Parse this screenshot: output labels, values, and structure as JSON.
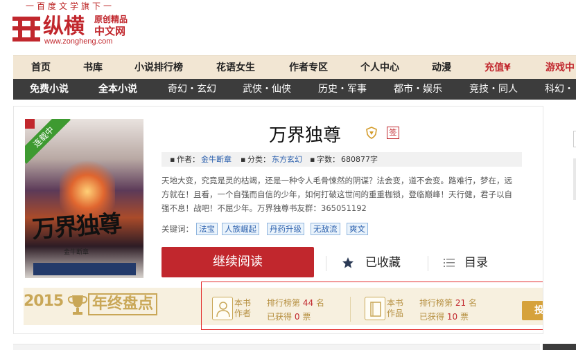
{
  "header": {
    "slogan": "一百度文学旗下一",
    "logo_main": "纵横",
    "logo_sub1": "原创精品",
    "logo_sub2": "中文网",
    "logo_url": "www.zongheng.com"
  },
  "nav_main": [
    {
      "label": "首页"
    },
    {
      "label": "书库"
    },
    {
      "label": "小说排行榜"
    },
    {
      "label": "花语女生"
    },
    {
      "label": "作者专区"
    },
    {
      "label": "个人中心"
    },
    {
      "label": "动漫"
    },
    {
      "label": "充值¥"
    },
    {
      "label": "游戏中"
    }
  ],
  "nav_sub": [
    {
      "label": "免费小说"
    },
    {
      "label": "全本小说"
    },
    {
      "label": "奇幻・玄幻"
    },
    {
      "label": "武侠・仙侠"
    },
    {
      "label": "历史・军事"
    },
    {
      "label": "都市・娱乐"
    },
    {
      "label": "竞技・同人"
    },
    {
      "label": "科幻・灵"
    }
  ],
  "book": {
    "status_ribbon": "连载中",
    "cover_title": "万界独尊",
    "cover_author": "金牛断章",
    "title": "万界独尊",
    "sign_badge": "签",
    "meta": {
      "author_label": "作者：",
      "author": "金牛断章",
      "category_label": "分类：",
      "category": "东方玄幻",
      "words_label": "字数：",
      "words": "680877字"
    },
    "description": "天地大变，究竟是灵的枯竭，还是一种令人毛骨悚然的阴谋？法会变，道不会变。路难行，梦在，远方就在！且看，一个自强而自信的少年，如何打破这世间的重重枷锁，登临巅峰！天行健，君子以自强不息！战吧！不屈少年。万界独尊书友群：365051192",
    "keywords_label": "关键词：",
    "keywords": [
      "法宝",
      "人族崛起",
      "丹药升级",
      "无敌流",
      "爽文"
    ],
    "read_button": "继续阅读",
    "fav_button": "已收藏",
    "toc_button": "目录"
  },
  "award": {
    "year": "2015",
    "title": "年终盘点",
    "author_stat": {
      "icon_label": "本书作者",
      "rank_label": "排行榜第",
      "rank": "44",
      "rank_unit": "名",
      "got_label": "已获得",
      "votes": "0",
      "votes_unit": "票"
    },
    "work_stat": {
      "icon_label": "本书作品",
      "rank_label": "排行榜第",
      "rank": "21",
      "rank_unit": "名",
      "got_label": "已获得",
      "votes": "10",
      "votes_unit": "票"
    },
    "vote_button": "投作品"
  },
  "colors": {
    "brand_red": "#c1272d",
    "nav_bg": "#f2e6d3",
    "subnav_bg": "#3c3c3c",
    "gold": "#c9a757"
  }
}
